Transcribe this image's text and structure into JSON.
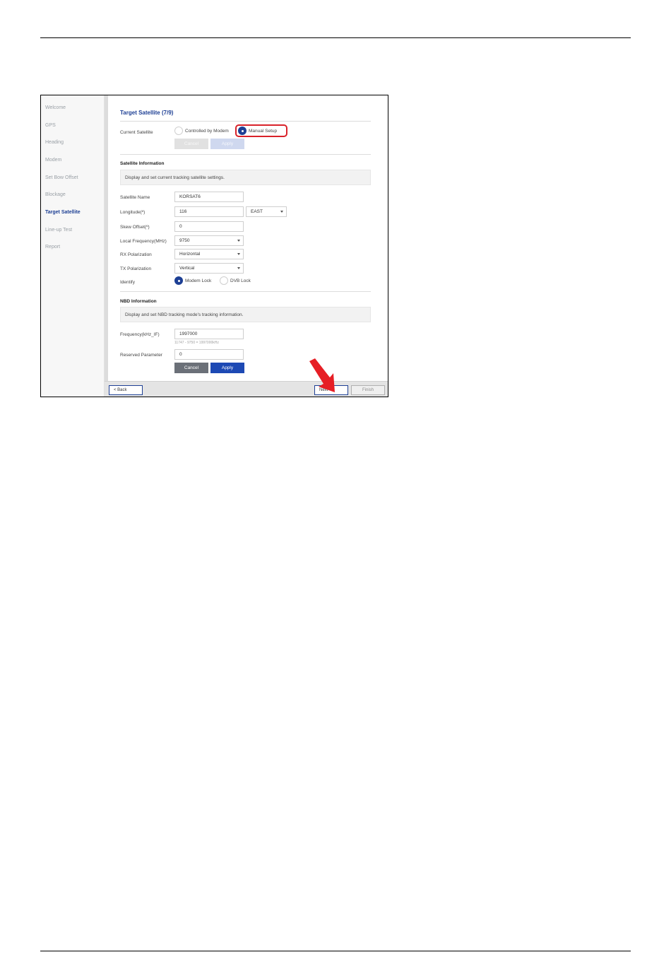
{
  "sidebar": {
    "items": [
      {
        "label": "Welcome"
      },
      {
        "label": "GPS"
      },
      {
        "label": "Heading"
      },
      {
        "label": "Modem"
      },
      {
        "label": "Set Bow Offset"
      },
      {
        "label": "Blockage"
      },
      {
        "label": "Target Satellite",
        "active": true
      },
      {
        "label": "Line-up Test"
      },
      {
        "label": "Report"
      }
    ]
  },
  "page": {
    "title": "Target Satellite (7/9)"
  },
  "current_satellite": {
    "label": "Current Satellite",
    "options": [
      "Controlled by Modem",
      "Manual Setup"
    ],
    "selected": "Manual Setup",
    "cancel_label": "Cancel",
    "apply_label": "Apply"
  },
  "satellite_info": {
    "heading": "Satellite Information",
    "description": "Display and set current tracking satellite settings.",
    "fields": {
      "name": {
        "label": "Satellite Name",
        "value": "KORSAT6"
      },
      "longitude": {
        "label": "Longitude(º)",
        "value": "116",
        "direction": "EAST"
      },
      "skew": {
        "label": "Skew Offset(º)",
        "value": "0"
      },
      "local_freq": {
        "label": "Local Frequency(MHz)",
        "value": "9750"
      },
      "rx_pol": {
        "label": "RX Polarization",
        "value": "Horizontal"
      },
      "tx_pol": {
        "label": "TX Polarization",
        "value": "Vertical"
      },
      "identify": {
        "label": "Identify",
        "options": [
          "Modem Lock",
          "DVB Lock"
        ],
        "selected": "Modem Lock"
      }
    }
  },
  "nbd_info": {
    "heading": "NBD Information",
    "description": "Display and set NBD tracking mode's tracking information.",
    "frequency": {
      "label": "Frequency(kHz_IF)",
      "value": "1997000",
      "hint": "11747 - 9750 = 1997000kHz"
    },
    "reserved": {
      "label": "Reserved Parameter",
      "value": "0"
    },
    "cancel_label": "Cancel",
    "apply_label": "Apply"
  },
  "footer": {
    "back_label": "< Back",
    "next_label": "Next >",
    "finish_label": "Finish"
  },
  "colors": {
    "accent": "#1d3f94",
    "highlight": "#d9222a"
  }
}
